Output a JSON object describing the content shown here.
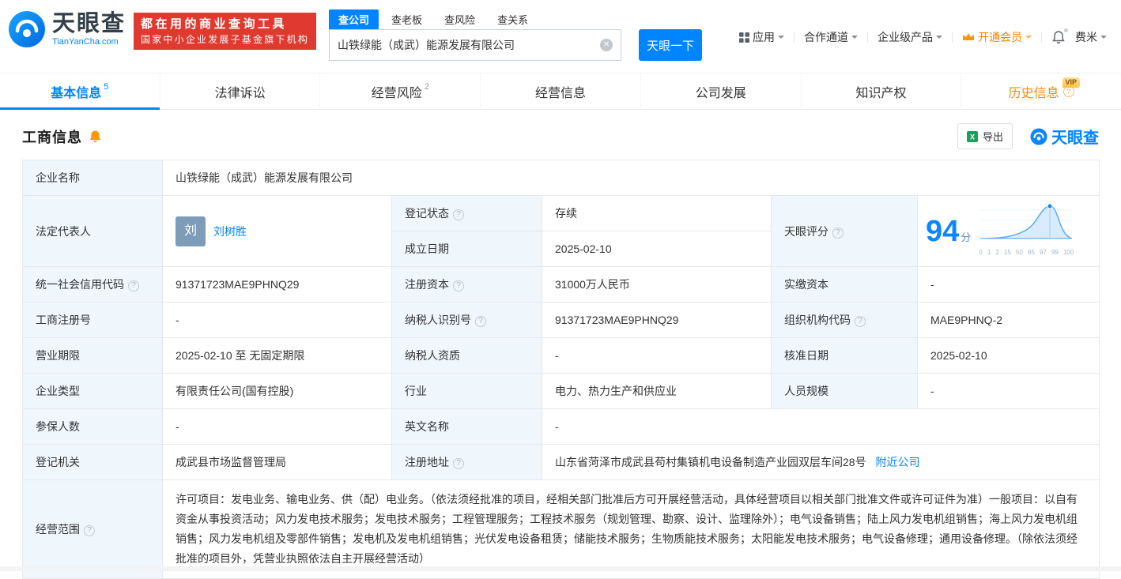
{
  "colors": {
    "accent": "#0084ff",
    "banner_red": "#e0392f",
    "member_orange": "#ff8000",
    "history_orange": "#ff8a00",
    "status_green": "#00a854",
    "label_cell_bg": "#eff7fd"
  },
  "icons": {
    "help": "?",
    "clear": "✕"
  },
  "brand": {
    "name": "天眼查",
    "domain": "TianYanCha.com",
    "slogan_line1": "都在用的商业查询工具",
    "slogan_line2": "国家中小企业发展子基金旗下机构"
  },
  "search": {
    "tabs": [
      {
        "label": "查公司",
        "active": true
      },
      {
        "label": "查老板",
        "active": false
      },
      {
        "label": "查风险",
        "active": false
      },
      {
        "label": "查关系",
        "active": false
      }
    ],
    "input_value": "山铁绿能（成武）能源发展有限公司",
    "button_label": "天眼一下"
  },
  "top_menu": {
    "apps": "应用",
    "partner": "合作通道",
    "enterprise": "企业级产品",
    "vip": "开通会员",
    "user": "费米"
  },
  "nav_tabs": [
    {
      "label": "基本信息",
      "badge": "5"
    },
    {
      "label": "法律诉讼",
      "badge": ""
    },
    {
      "label": "经营风险",
      "badge": "2"
    },
    {
      "label": "经营信息",
      "badge": ""
    },
    {
      "label": "公司发展",
      "badge": ""
    },
    {
      "label": "知识产权",
      "badge": ""
    },
    {
      "label": "历史信息",
      "badge": "VIP"
    }
  ],
  "section": {
    "title": "工商信息",
    "export_label": "导出",
    "watermark": "天眼查"
  },
  "fields": {
    "company_name": {
      "label": "企业名称",
      "value": "山铁绿能（成武）能源发展有限公司"
    },
    "legal_rep": {
      "label": "法定代表人",
      "avatar": "刘",
      "value": "刘树胜"
    },
    "reg_status": {
      "label": "登记状态",
      "value": "存续"
    },
    "establish_date": {
      "label": "成立日期",
      "value": "2025-02-10"
    },
    "tyc_score": {
      "label": "天眼评分",
      "value": "94",
      "unit": "分",
      "ticks": [
        "0",
        "1",
        "2",
        "15",
        "50",
        "65",
        "97",
        "99",
        "100"
      ]
    },
    "credit_code": {
      "label": "统一社会信用代码",
      "value": "91371723MAE9PHNQ29"
    },
    "reg_capital": {
      "label": "注册资本",
      "value": "31000万人民币"
    },
    "paid_capital": {
      "label": "实缴资本",
      "value": "-"
    },
    "reg_number": {
      "label": "工商注册号",
      "value": "-"
    },
    "taxpayer_id": {
      "label": "纳税人识别号",
      "value": "91371723MAE9PHNQ29"
    },
    "org_code": {
      "label": "组织机构代码",
      "value": "MAE9PHNQ-2"
    },
    "business_term": {
      "label": "营业期限",
      "value": "2025-02-10 至 无固定期限"
    },
    "taxpayer_quality": {
      "label": "纳税人资质",
      "value": "-"
    },
    "approve_date": {
      "label": "核准日期",
      "value": "2025-02-10"
    },
    "company_type": {
      "label": "企业类型",
      "value": "有限责任公司(国有控股)"
    },
    "industry": {
      "label": "行业",
      "value": "电力、热力生产和供应业"
    },
    "staff_size": {
      "label": "人员规模",
      "value": "-"
    },
    "insured_count": {
      "label": "参保人数",
      "value": "-"
    },
    "english_name": {
      "label": "英文名称",
      "value": "-"
    },
    "reg_authority": {
      "label": "登记机关",
      "value": "成武县市场监督管理局"
    },
    "reg_address": {
      "label": "注册地址",
      "value": "山东省菏泽市成武县苟村集镇机电设备制造产业园双层车间28号",
      "nearby_link": "附近公司"
    },
    "business_scope": {
      "label": "经营范围",
      "value": "许可项目：发电业务、输电业务、供（配）电业务。（依法须经批准的项目，经相关部门批准后方可开展经营活动，具体经营项目以相关部门批准文件或许可证件为准）一般项目：以自有资金从事投资活动；风力发电技术服务；发电技术服务；工程管理服务；工程技术服务（规划管理、勘察、设计、监理除外）；电气设备销售；陆上风力发电机组销售；海上风力发电机组销售；风力发电机组及零部件销售；发电机及发电机组销售；光伏发电设备租赁；储能技术服务；生物质能技术服务；太阳能发电技术服务；电气设备修理；通用设备修理。（除依法须经批准的项目外，凭营业执照依法自主开展经营活动）"
    }
  }
}
